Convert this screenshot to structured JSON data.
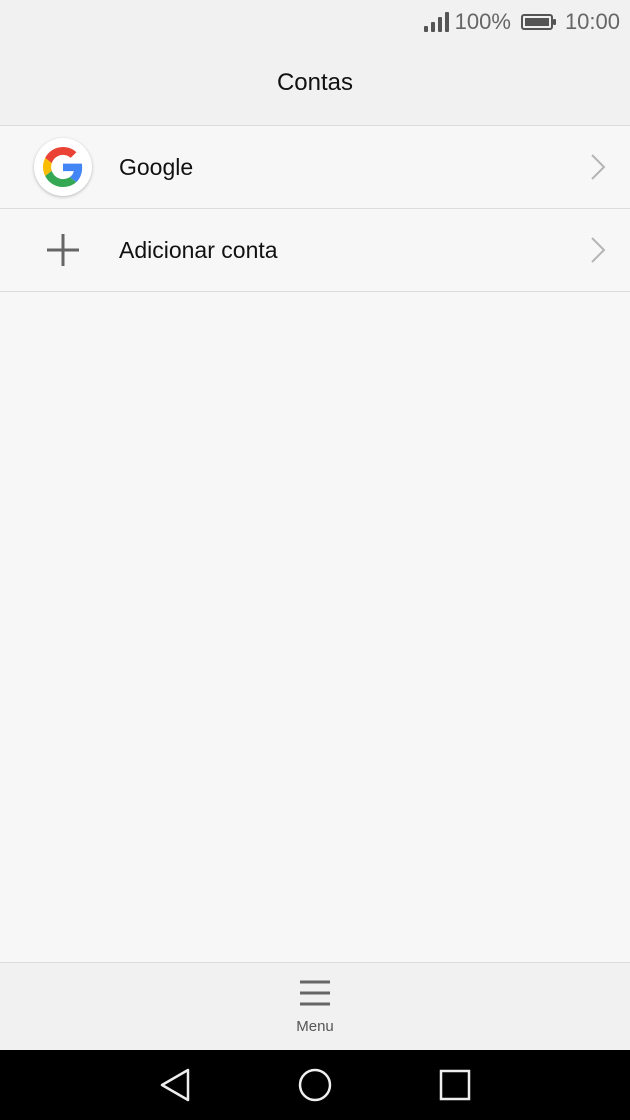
{
  "status_bar": {
    "battery_percent": "100%",
    "battery_level": 1.0,
    "time": "10:00",
    "icons": [
      "signal-icon",
      "battery-icon"
    ]
  },
  "header": {
    "title": "Contas"
  },
  "accounts": {
    "items": [
      {
        "label": "Google",
        "icon": "google-logo-icon"
      },
      {
        "label": "Adicionar conta",
        "icon": "plus-icon"
      }
    ]
  },
  "bottom_bar": {
    "menu_label": "Menu",
    "menu_icon": "hamburger-icon"
  },
  "nav_bar": {
    "icons": [
      "back-icon",
      "home-icon",
      "recents-icon"
    ]
  },
  "colors": {
    "background": "#f7f7f7",
    "bar_background": "#f1f1f1",
    "divider": "#dcdcdc",
    "google_blue": "#4285F4",
    "google_red": "#EA4335",
    "google_yellow": "#FBBC05",
    "google_green": "#34A853"
  }
}
